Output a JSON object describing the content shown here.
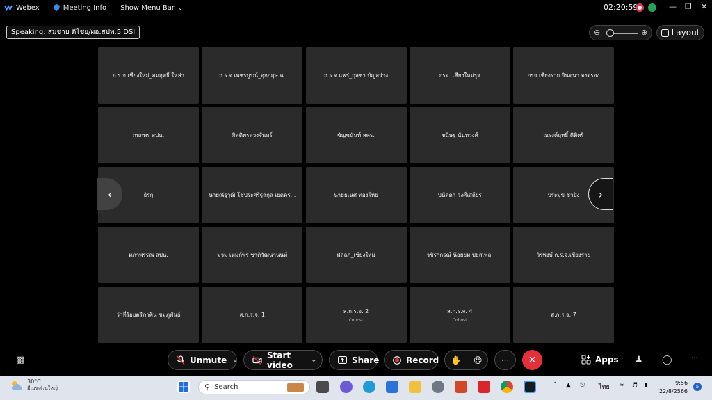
{
  "topbar": {
    "app_name": "Webex",
    "meeting_info": "Meeting Info",
    "show_menu_bar": "Show Menu Bar",
    "time": "02:20:59"
  },
  "speaking": "Speaking: สมชาย ติไชย/ผอ.สปพ.5 DSI",
  "layout_label": "Layout",
  "tiles": [
    {
      "name": "ก.ร.จ.เชียงใหม่_สมฤทธิ์  ใหล่า",
      "sub": ""
    },
    {
      "name": "ก.ร.จ.เพชรบูรณ์_อุกกฤษ ฉ.",
      "sub": ""
    },
    {
      "name": "ก.ร.จ.แพร่_กุลชา บัญสว่าง",
      "sub": ""
    },
    {
      "name": "กรจ. เชียงใหม่รุจ",
      "sub": ""
    },
    {
      "name": "กรจ.เชียงราย จินตนา จงตรอง",
      "sub": ""
    },
    {
      "name": "กนกพร สปน.",
      "sub": ""
    },
    {
      "name": "กิตติพรดวงจันทร์",
      "sub": ""
    },
    {
      "name": "ขัญชนันท์ สคร.",
      "sub": ""
    },
    {
      "name": "ขนิษฐ นันทวงศ์",
      "sub": ""
    },
    {
      "name": "ณรงค์ฤทธิ์ คิติศรี",
      "sub": ""
    },
    {
      "name": "ธิรกุ",
      "sub": ""
    },
    {
      "name": "นายณัฐวุฒิ โชประศรีฐสกุล เยตคร...",
      "sub": ""
    },
    {
      "name": "นายธเนศ ทองโหย",
      "sub": ""
    },
    {
      "name": "ปนัดดา วงศ์เสถียร",
      "sub": ""
    },
    {
      "name": "ประมุข ชาปัง",
      "sub": ""
    },
    {
      "name": "มภาพรรณ สปน.",
      "sub": ""
    },
    {
      "name": "ม่วม เหมก์พร ชาติวัฒนานนท์",
      "sub": ""
    },
    {
      "name": "พัลลภ_เชียงใหม่",
      "sub": ""
    },
    {
      "name": "วชิรากรณ์ น้อยยม ปยส.พล.",
      "sub": ""
    },
    {
      "name": "วิรพงษ์ ก.ร.จ.เชียงราย",
      "sub": ""
    },
    {
      "name": "ว่าที่ร้อยตรีภาคิน ชมภูพันธ์",
      "sub": ""
    },
    {
      "name": "ส.ก.ร.จ. 1",
      "sub": ""
    },
    {
      "name": "ส.ก.ร.จ. 2",
      "sub": "Cohost"
    },
    {
      "name": "ส.ก.ร.จ. 4",
      "sub": "Cohost"
    },
    {
      "name": "ส.ก.ร.จ. 7",
      "sub": ""
    }
  ],
  "controls": {
    "unmute": "Unmute",
    "start_video": "Start video",
    "share": "Share",
    "record": "Record",
    "apps": "Apps"
  },
  "taskbar": {
    "temperature": "30°C",
    "weather_desc": "มีเมฆส่วนใหญ่",
    "search_placeholder": "Search",
    "language": "ไทย",
    "clock_time": "9:56",
    "clock_date": "22/8/2566",
    "notifications": "5"
  },
  "colors": {
    "accent_red": "#e52f3a",
    "tile_bg": "#2b2b2b",
    "taskbar_bg": "#dfe4ed"
  }
}
